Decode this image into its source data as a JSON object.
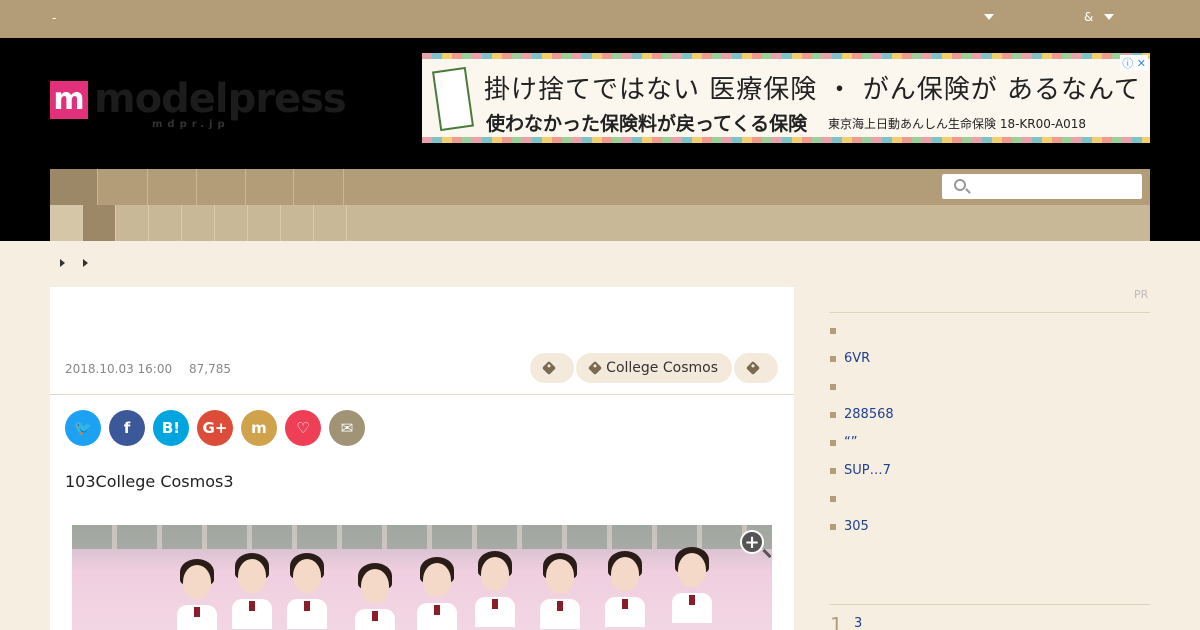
{
  "topbar": {
    "left_text": "-",
    "right_text": "&"
  },
  "logo": {
    "mark": "m",
    "word": "modelpress",
    "sub": "mdpr.jp"
  },
  "ad": {
    "line1": "掛け捨てではない 医療保険 ・ がん保険が あるなんて",
    "line2": "使わなかった保険料が戻ってくる保険",
    "line3": "東京海上日動あんしん生命保険 18-KR00-A018",
    "close": "ⓘ ✕"
  },
  "search": {
    "placeholder": "",
    "value": ""
  },
  "article": {
    "date": "2018.10.03 16:00",
    "views": "87,785",
    "tags": [
      "",
      "College Cosmos",
      ""
    ],
    "lead": "103College Cosmos3",
    "share_buttons": [
      {
        "name": "twitter",
        "glyph": "🐦",
        "color": "#1da1f2"
      },
      {
        "name": "facebook",
        "glyph": "f",
        "color": "#3b5998"
      },
      {
        "name": "hatena",
        "glyph": "B!",
        "color": "#00a4de"
      },
      {
        "name": "google-plus",
        "glyph": "G+",
        "color": "#dd4b39"
      },
      {
        "name": "mixi",
        "glyph": "m",
        "color": "#d1a24c"
      },
      {
        "name": "pocket",
        "glyph": "♡",
        "color": "#ef3f56"
      },
      {
        "name": "mail",
        "glyph": "✉",
        "color": "#a09376"
      }
    ]
  },
  "sidebar": {
    "pr_label": "PR",
    "items": [
      "",
      "6VR",
      "",
      "288568",
      "“”",
      "SUP…7",
      "",
      "305"
    ],
    "ranking": {
      "number": "1",
      "text": "3"
    }
  },
  "colors": {
    "brand": "#e2317b",
    "nav": "#b29d78",
    "page_bg": "#f6efe1"
  }
}
